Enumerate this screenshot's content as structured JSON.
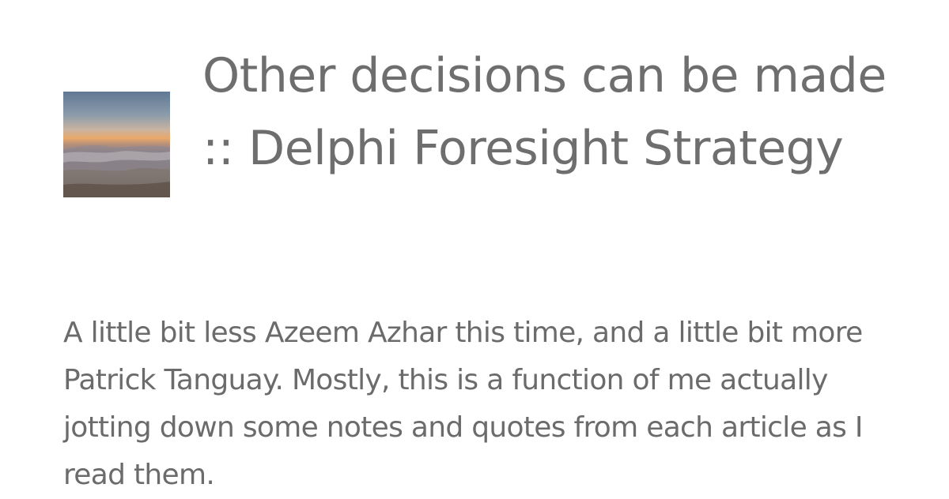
{
  "post": {
    "title": "Other decisions can be made :: Delphi Foresight Strategy",
    "excerpt": "A little bit less Azeem Azhar this time, and a little bit more Patrick Tanguay. Mostly, this is a function of me actually jotting down some notes and quotes from each article as I read them.",
    "thumbnail_icon": "sunset-landscape-photo"
  }
}
